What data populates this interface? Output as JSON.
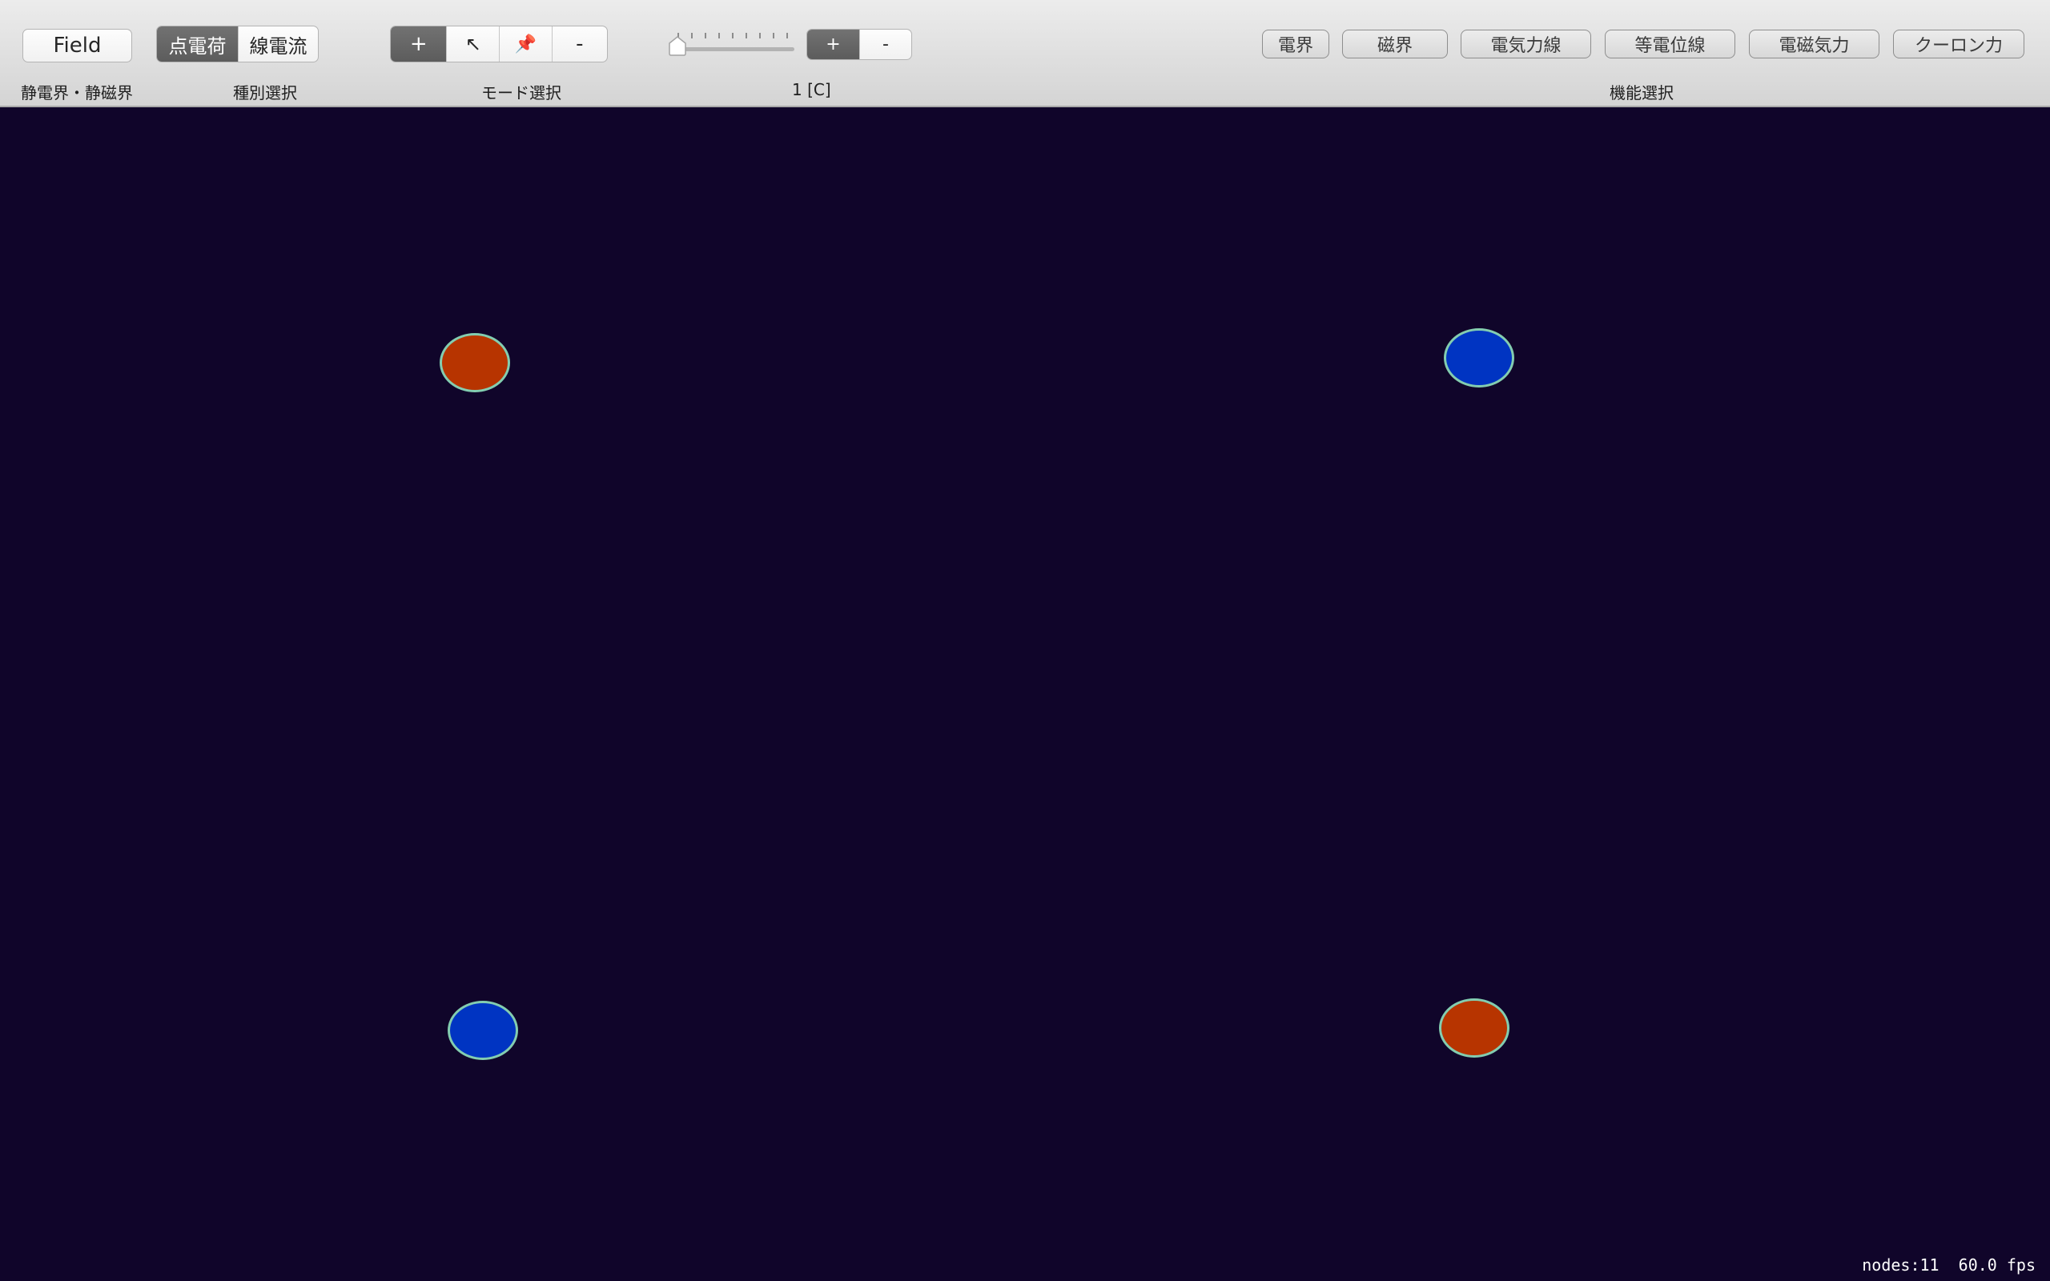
{
  "toolbar": {
    "field_button": "Field",
    "type_segment": [
      {
        "label": "点電荷",
        "selected": true
      },
      {
        "label": "線電流",
        "selected": false
      }
    ],
    "mode_segment": [
      {
        "label": "+",
        "icon": "plus",
        "selected": true
      },
      {
        "label": "↖",
        "icon": "pointer-arrow-icon",
        "selected": false
      },
      {
        "label": "📌",
        "icon": "pin-icon",
        "selected": false
      },
      {
        "label": "-",
        "icon": "minus",
        "selected": false
      }
    ],
    "charge_slider": {
      "value_fraction": 0.0
    },
    "sign_segment": [
      {
        "label": "+",
        "selected": true
      },
      {
        "label": "-",
        "selected": false
      }
    ],
    "captions": {
      "field": "静電界・静磁界",
      "type": "種別選択",
      "mode": "モード選択",
      "charge_value": "1 [C]",
      "functions": "機能選択"
    },
    "function_buttons": [
      "電界",
      "磁界",
      "電気力線",
      "等電位線",
      "電磁気力",
      "クーロン力"
    ]
  },
  "canvas": {
    "background": "#10052a",
    "charges": [
      {
        "sign": "positive",
        "color": "#b73400"
      },
      {
        "sign": "negative",
        "color": "#0034c2"
      },
      {
        "sign": "negative",
        "color": "#0034c2"
      },
      {
        "sign": "positive",
        "color": "#b73400"
      }
    ]
  },
  "status": {
    "nodes": "nodes:11",
    "fps": "60.0 fps"
  }
}
